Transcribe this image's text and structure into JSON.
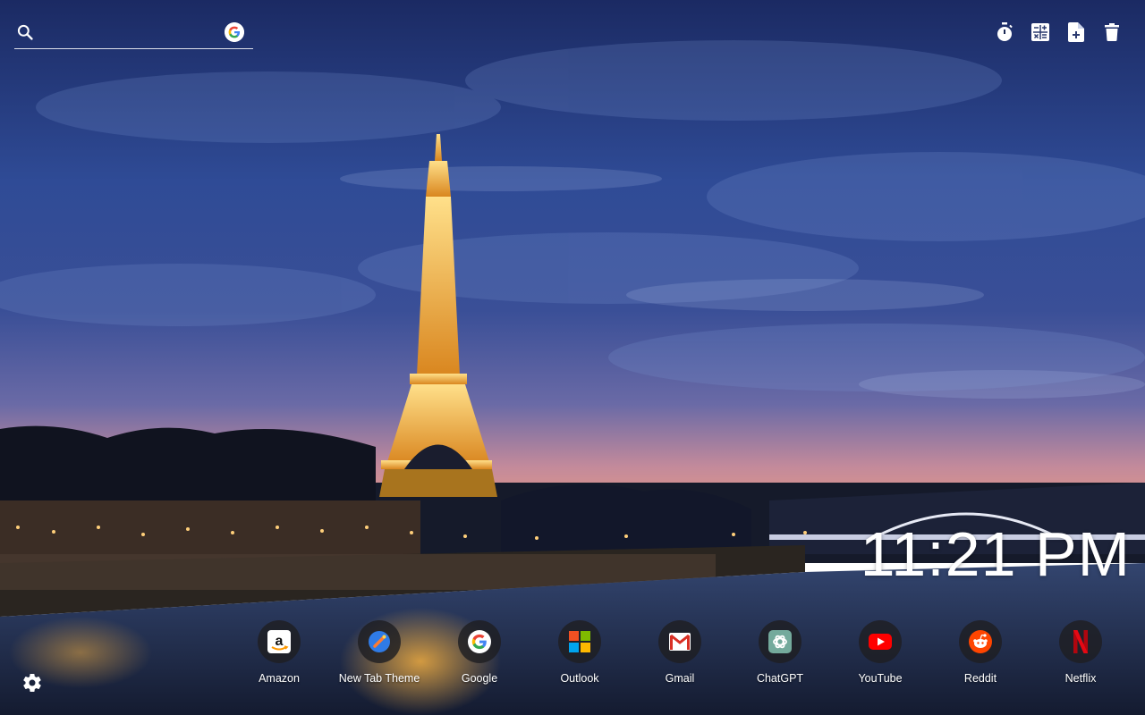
{
  "search": {
    "value": "",
    "placeholder": "",
    "engine_icon": "google-g-icon"
  },
  "toolbar": [
    {
      "name": "timer-button",
      "icon": "stopwatch-icon"
    },
    {
      "name": "calculator-button",
      "icon": "calculator-icon"
    },
    {
      "name": "new-note-button",
      "icon": "note-add-icon"
    },
    {
      "name": "delete-button",
      "icon": "trash-icon"
    }
  ],
  "clock": {
    "time": "11:21 PM"
  },
  "shortcuts": [
    {
      "label": "Amazon",
      "icon": "amazon-icon"
    },
    {
      "label": "New Tab Theme",
      "icon": "new-tab-theme-icon"
    },
    {
      "label": "Google",
      "icon": "google-icon"
    },
    {
      "label": "Outlook",
      "icon": "microsoft-icon"
    },
    {
      "label": "Gmail",
      "icon": "gmail-icon"
    },
    {
      "label": "ChatGPT",
      "icon": "chatgpt-icon"
    },
    {
      "label": "YouTube",
      "icon": "youtube-icon"
    },
    {
      "label": "Reddit",
      "icon": "reddit-icon"
    },
    {
      "label": "Netflix",
      "icon": "netflix-icon"
    }
  ],
  "settings": {
    "icon": "gear-icon"
  },
  "colors": {
    "sky_top": "#1d2f6e",
    "sky_mid": "#3b5aa6",
    "horizon": "#e08f86",
    "water": "#1f2a4a",
    "tower_glow": "#f2b640",
    "youtube_red": "#ff0000",
    "netflix_red": "#e50914",
    "reddit_orange": "#ff4500"
  }
}
